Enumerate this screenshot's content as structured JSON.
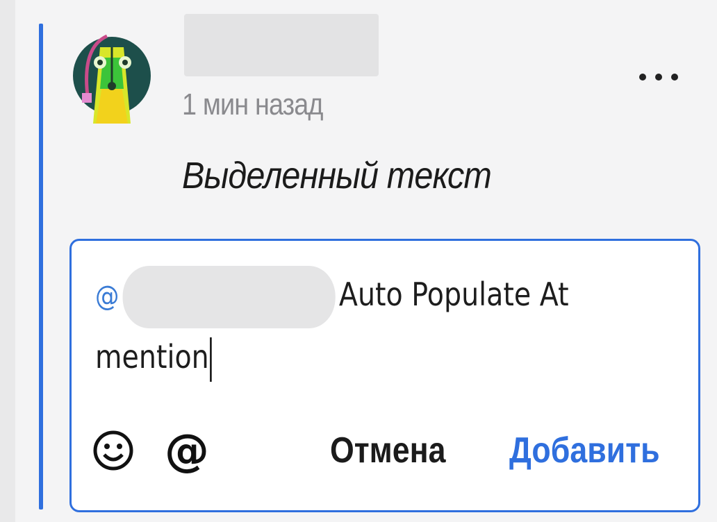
{
  "comment": {
    "author_name": "",
    "timestamp": "1 мин назад",
    "highlighted_text": "Выделенный текст",
    "avatar": "chameleon-avatar-icon",
    "menu_icon": "more-horizontal-icon"
  },
  "reply": {
    "mention_prefix": "@",
    "mentioned_user": "",
    "text_line1": "Auto Populate At",
    "text_line2": "mention"
  },
  "toolbar": {
    "emoji_icon": "smiley-icon",
    "mention_icon_label": "@",
    "cancel_label": "Отмена",
    "add_label": "Добавить"
  },
  "colors": {
    "accent": "#2f6fde",
    "mention": "#3a7bd5",
    "background": "#f4f4f5"
  }
}
